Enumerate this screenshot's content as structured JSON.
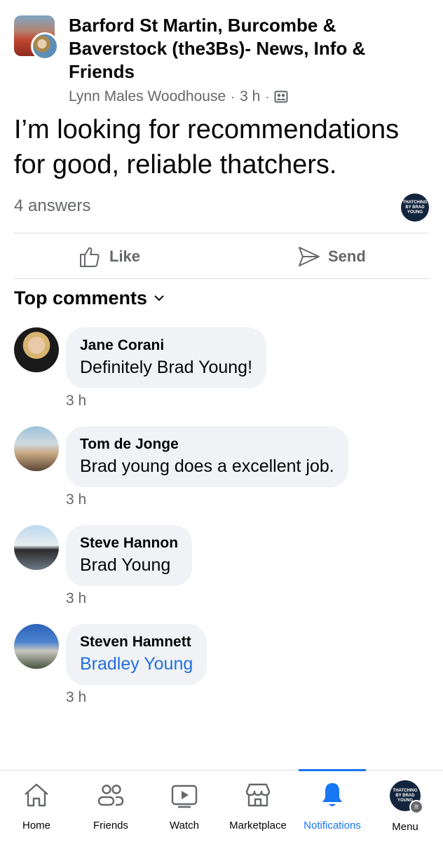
{
  "post": {
    "group_name": "Barford St Martin, Burcombe & Baverstock (the3Bs)- News, Info & Friends",
    "author": "Lynn Males Woodhouse",
    "time": "3 h",
    "text": "I’m looking for recommendations for good, reliable thatchers.",
    "answers": "4 answers",
    "badge_text": "THATCHING BY BRAD YOUNG"
  },
  "actions": {
    "like": "Like",
    "send": "Send"
  },
  "comments_header": {
    "label": "Top comments",
    "chevron": "⌄"
  },
  "comments": [
    {
      "name": "Jane Corani",
      "text": "Definitely Brad Young!",
      "time": "3 h"
    },
    {
      "name": "Tom de Jonge",
      "text": "Brad young does a excellent job.",
      "time": "3 h"
    },
    {
      "name": "Steve Hannon",
      "text": "Brad Young",
      "time": "3 h"
    },
    {
      "name": "Steven Hamnett",
      "text": "Bradley Young",
      "time": "3 h"
    }
  ],
  "tabbar": {
    "home": "Home",
    "friends": "Friends",
    "watch": "Watch",
    "marketplace": "Marketplace",
    "notifications": "Notifications",
    "menu": "Menu",
    "active": "notifications"
  },
  "colors": {
    "accent": "#1877f2",
    "link": "#216fdb",
    "secondary_text": "#65676b",
    "bubble": "#f0f2f5"
  }
}
